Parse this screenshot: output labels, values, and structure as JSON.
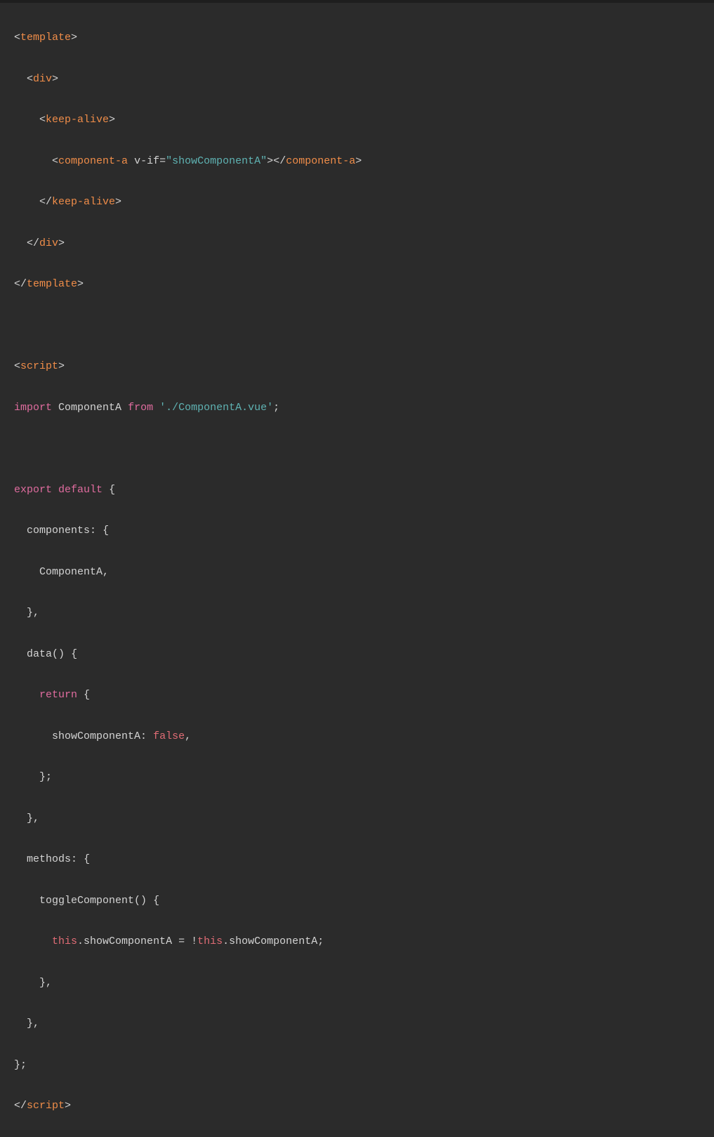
{
  "code": {
    "l1": {
      "open": "<",
      "tag": "template",
      "close": ">"
    },
    "l2": {
      "open": "<",
      "tag": "div",
      "close": ">"
    },
    "l3": {
      "open": "<",
      "tag": "keep-alive",
      "close": ">"
    },
    "l4": {
      "open": "<",
      "tag": "component-a",
      "sp": " ",
      "attr": "v-if",
      "eq": "=",
      "q1": "\"",
      "val": "showComponentA",
      "q2": "\"",
      "close1": ">",
      "open2": "</",
      "tag2": "component-a",
      "close2": ">"
    },
    "l5": {
      "open": "</",
      "tag": "keep-alive",
      "close": ">"
    },
    "l6": {
      "open": "</",
      "tag": "div",
      "close": ">"
    },
    "l7": {
      "open": "</",
      "tag": "template",
      "close": ">"
    },
    "l8": "",
    "l9": {
      "open": "<",
      "tag": "script",
      "close": ">"
    },
    "l10": {
      "kw": "import",
      "sp1": " ",
      "ident": "ComponentA",
      "sp2": " ",
      "kw2": "from",
      "sp3": " ",
      "q1": "'",
      "str": "./ComponentA.vue",
      "q2": "'",
      "semi": ";"
    },
    "l11": "",
    "l12": {
      "kw": "export",
      "sp1": " ",
      "kw2": "default",
      "sp2": " ",
      "brace": "{"
    },
    "l13": {
      "prop": "components",
      "colon": ":",
      "sp": " ",
      "brace": "{"
    },
    "l14": {
      "ident": "ComponentA",
      "comma": ","
    },
    "l15": {
      "brace": "}",
      "comma": ","
    },
    "l16": {
      "fn": "data",
      "paren": "()",
      "sp": " ",
      "brace": "{"
    },
    "l17": {
      "kw": "return",
      "sp": " ",
      "brace": "{"
    },
    "l18": {
      "prop": "showComponentA",
      "colon": ":",
      "sp": " ",
      "bool": "false",
      "comma": ","
    },
    "l19": {
      "brace": "}",
      "semi": ";"
    },
    "l20": {
      "brace": "}",
      "comma": ","
    },
    "l21": {
      "prop": "methods",
      "colon": ":",
      "sp": " ",
      "brace": "{"
    },
    "l22": {
      "fn": "toggleComponent",
      "paren": "()",
      "sp": " ",
      "brace": "{"
    },
    "l23": {
      "this1": "this",
      "dot1": ".",
      "prop1": "showComponentA",
      "sp1": " ",
      "eq": "=",
      "sp2": " ",
      "bang": "!",
      "this2": "this",
      "dot2": ".",
      "prop2": "showComponentA",
      "semi": ";"
    },
    "l24": {
      "brace": "}",
      "comma": ","
    },
    "l25": {
      "brace": "}",
      "comma": ","
    },
    "l26": {
      "brace": "}",
      "semi": ";"
    },
    "l27": {
      "open": "</",
      "tag": "script",
      "close": ">"
    }
  },
  "indent": {
    "i0": "",
    "i1": "  ",
    "i2": "    ",
    "i3": "      ",
    "i4": "        "
  }
}
